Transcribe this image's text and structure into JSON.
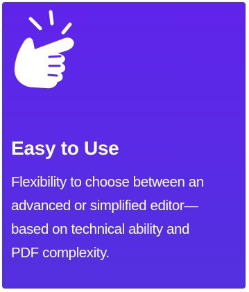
{
  "card": {
    "background": "#5a2ae6",
    "icon": "pointing-hand-icon",
    "title": "Easy to Use",
    "description_lines": [
      "Flexibility to choose between an",
      "advanced or simplified editor—",
      "based on technical ability and",
      "PDF complexity."
    ]
  }
}
